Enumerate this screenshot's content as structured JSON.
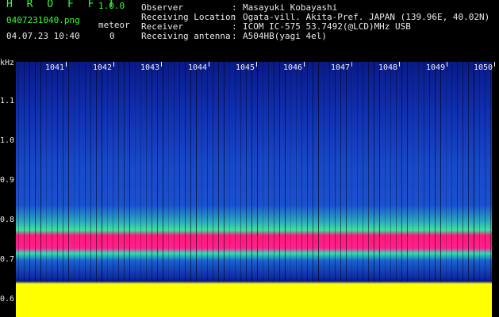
{
  "header": {
    "app_name": "H R O F F T",
    "version": "1.0.0",
    "filename": "0407231040.png",
    "datetime": "04.07.23 10:40",
    "meteor_label": "meteor",
    "meteor_count": "0"
  },
  "station": {
    "observer_label": "Observer",
    "observer": "Masayuki Kobayashi",
    "location_label": "Receiving Location",
    "location": "Ogata-vill. Akita-Pref. JAPAN (139.96E, 40.02N)",
    "receiver_label": "Receiver",
    "receiver": "ICOM IC-575 53.7492(@LCD)MHz USB",
    "antenna_label": "Receiving antenna",
    "antenna": "A504HB(yagi 4el)",
    "colon": ":"
  },
  "spectrogram": {
    "y_unit": "kHz",
    "y_ticks": [
      "1.1",
      "1.0",
      "0.9",
      "0.8",
      "0.7",
      "0.6"
    ],
    "x_ticks": [
      "1041",
      "1042",
      "1043",
      "1044",
      "1045",
      "1046",
      "1047",
      "1048",
      "1049",
      "1050"
    ],
    "colors": {
      "background": "#1030b0",
      "echo_band": "#ff2090",
      "noise_floor": "#ffff00"
    }
  }
}
